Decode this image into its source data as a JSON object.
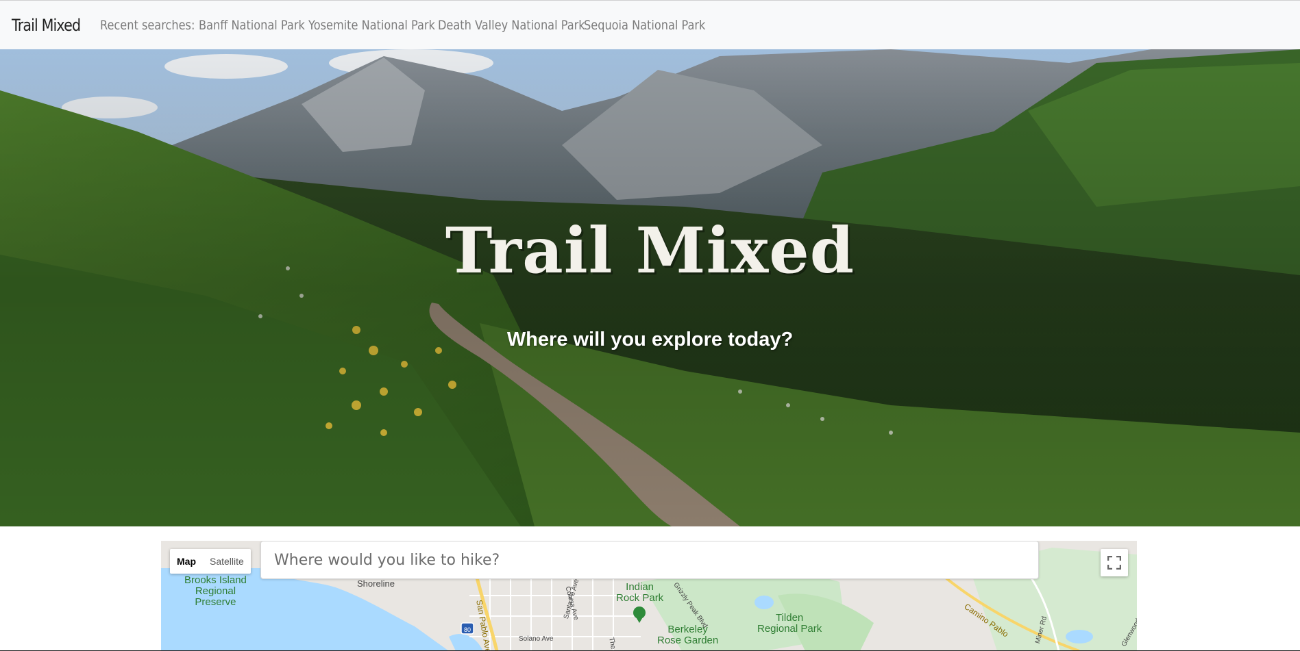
{
  "navbar": {
    "brand": "Trail Mixed",
    "recent_label": "Recent searches:",
    "recent_searches": [
      "Banff National Park",
      "Yosemite National Park",
      "Death Valley National Park",
      "Sequoia National Park"
    ]
  },
  "hero": {
    "title": "Trail Mixed",
    "subtitle": "Where will you explore today?"
  },
  "map": {
    "type_buttons": [
      "Map",
      "Satellite"
    ],
    "active_type": "Map",
    "search_placeholder": "Where would you like to hike?",
    "labels": {
      "brooks": "Brooks Island\nRegional\nPreserve",
      "shoreline": "Shoreline",
      "indian_rock": "Indian\nRock Park",
      "berkeley_rose": "Berkeley\nRose Garden",
      "tilden": "Tilden\nRegional Park",
      "san_pablo": "San Pablo Ave",
      "colusa": "Colusa Ave",
      "santa_fe": "Santa Fe Ave",
      "solano": "Solano Ave",
      "grizzly": "Grizzly Peak Blvd",
      "camino_pablo": "Camino Pablo",
      "miner_rd": "Miner Rd",
      "glenwood": "Glenwood Dr",
      "the": "The",
      "i80": "80"
    }
  }
}
